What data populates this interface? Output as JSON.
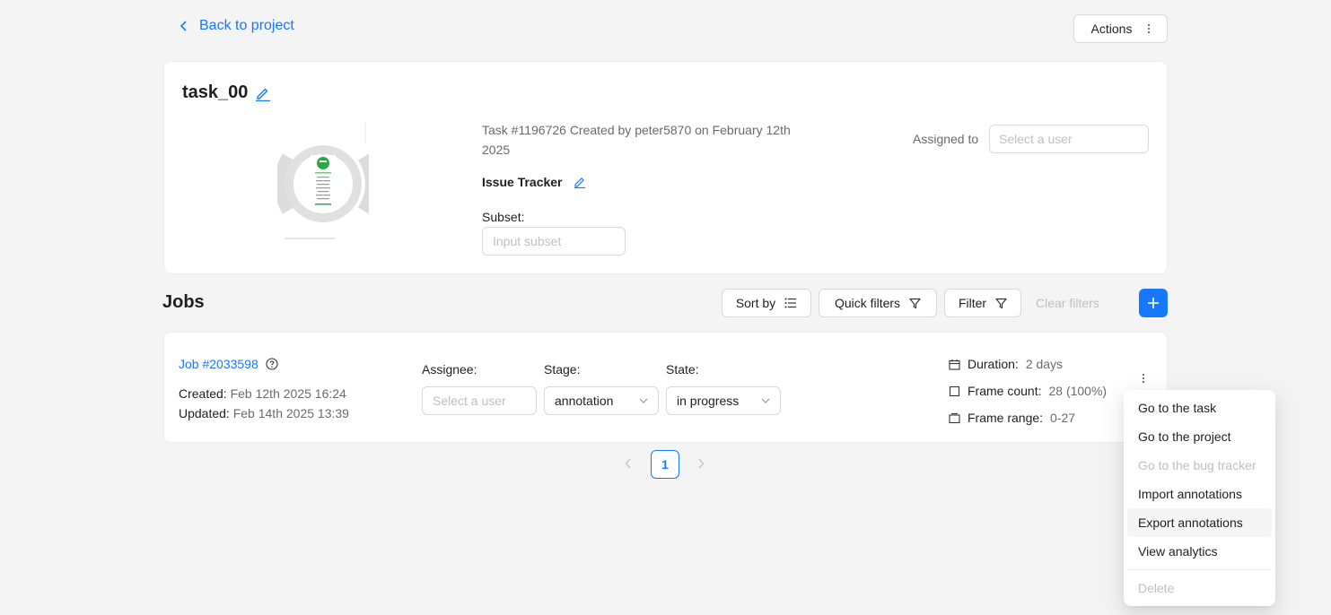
{
  "nav": {
    "back_label": "Back to project",
    "actions_label": "Actions"
  },
  "task": {
    "title": "task_00",
    "info": "Task #1196726 Created by peter5870 on February 12th 2025",
    "issue_tracker_label": "Issue Tracker",
    "subset_label": "Subset:",
    "subset_placeholder": "Input subset",
    "assigned_label": "Assigned to",
    "assigned_placeholder": "Select a user"
  },
  "jobs_section": {
    "title": "Jobs",
    "sort_label": "Sort by",
    "quick_filters_label": "Quick filters",
    "filter_label": "Filter",
    "clear_filters_label": "Clear filters"
  },
  "job": {
    "link": "Job #2033598",
    "created_label": "Created:",
    "created_value": "Feb 12th 2025 16:24",
    "updated_label": "Updated:",
    "updated_value": "Feb 14th 2025 13:39",
    "assignee_label": "Assignee:",
    "assignee_placeholder": "Select a user",
    "stage_label": "Stage:",
    "stage_value": "annotation",
    "state_label": "State:",
    "state_value": "in progress",
    "duration_label": "Duration:",
    "duration_value": "2 days",
    "frame_count_label": "Frame count:",
    "frame_count_value": "28 (100%)",
    "frame_range_label": "Frame range:",
    "frame_range_value": "0-27"
  },
  "pagination": {
    "current_page": "1"
  },
  "context_menu": {
    "items": [
      {
        "label": "Go to the task",
        "disabled": false
      },
      {
        "label": "Go to the project",
        "disabled": false
      },
      {
        "label": "Go to the bug tracker",
        "disabled": true
      },
      {
        "label": "Import annotations",
        "disabled": false
      },
      {
        "label": "Export annotations",
        "disabled": false,
        "hovered": true
      },
      {
        "label": "View analytics",
        "disabled": false
      },
      {
        "label": "Delete",
        "disabled": true
      }
    ]
  },
  "colors": {
    "primary": "#1677ff",
    "muted": "#6b6b6b",
    "disabled": "#bfbfbf",
    "background": "#f4f4f4"
  }
}
